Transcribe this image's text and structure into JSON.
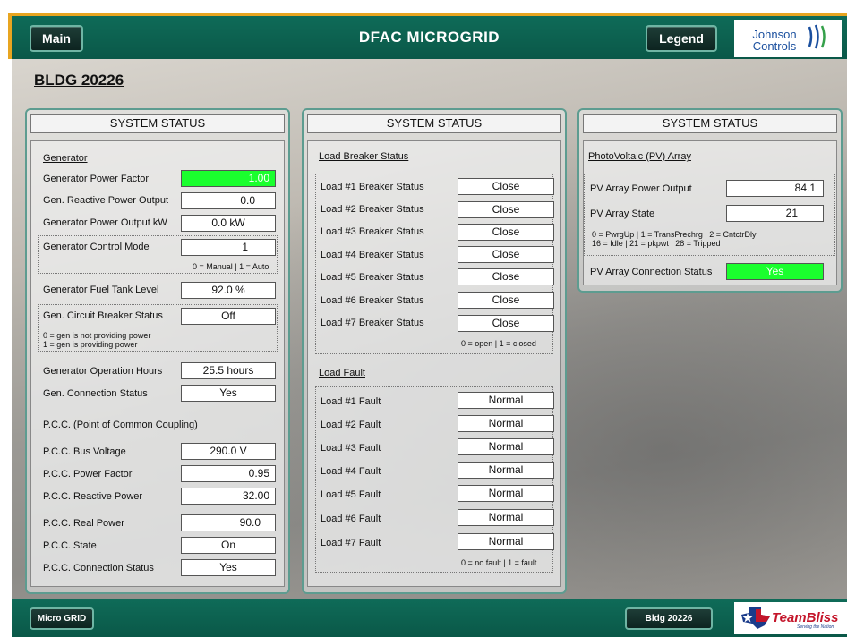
{
  "header": {
    "title": "DFAC MICROGRID",
    "main_label": "Main",
    "legend_label": "Legend",
    "logo_text_line1": "Johnson",
    "logo_text_line2": "Controls"
  },
  "page": {
    "building_title": "BLDG 20226"
  },
  "gen_panel": {
    "heading": "SYSTEM STATUS",
    "generator_section": "Generator",
    "power_factor_label": "Generator Power Factor",
    "power_factor_value": "1.00",
    "reactive_label": "Gen. Reactive Power Output",
    "reactive_value": "0.0",
    "output_kw_label": "Generator Power Output kW",
    "output_kw_value": "0.0 kW",
    "control_mode_label": "Generator Control Mode",
    "control_mode_value": "1",
    "control_mode_note": "0 = Manual | 1 = Auto",
    "fuel_label": "Generator Fuel Tank Level",
    "fuel_value": "92.0 %",
    "breaker_label": "Gen. Circuit Breaker Status",
    "breaker_value": "Off",
    "breaker_note1": "0 = gen is not providing power",
    "breaker_note2": "1 = gen is providing power",
    "hours_label": "Generator Operation Hours",
    "hours_value": "25.5 hours",
    "conn_label": "Gen. Connection Status",
    "conn_value": "Yes",
    "pcc_section": "P.C.C. (Point of Common Coupling)",
    "pcc_voltage_label": "P.C.C. Bus Voltage",
    "pcc_voltage_value": "290.0 V",
    "pcc_pf_label": "P.C.C. Power Factor",
    "pcc_pf_value": "0.95",
    "pcc_reactive_label": "P.C.C. Reactive Power",
    "pcc_reactive_value": "32.00",
    "pcc_real_label": "P.C.C. Real Power",
    "pcc_real_value": "90.0",
    "pcc_state_label": "P.C.C. State",
    "pcc_state_value": "On",
    "pcc_conn_label": "P.C.C. Connection Status",
    "pcc_conn_value": "Yes"
  },
  "load_panel": {
    "heading": "SYSTEM STATUS",
    "breaker_section": "Load Breaker Status",
    "breakers": [
      {
        "label": "Load #1 Breaker Status",
        "value": "Close"
      },
      {
        "label": "Load #2 Breaker Status",
        "value": "Close"
      },
      {
        "label": "Load #3 Breaker Status",
        "value": "Close"
      },
      {
        "label": "Load #4 Breaker Status",
        "value": "Close"
      },
      {
        "label": "Load #5 Breaker Status",
        "value": "Close"
      },
      {
        "label": "Load #6 Breaker Status",
        "value": "Close"
      },
      {
        "label": "Load #7 Breaker Status",
        "value": "Close"
      }
    ],
    "breaker_note": "0 = open | 1 = closed",
    "fault_section": "Load Fault",
    "faults": [
      {
        "label": "Load #1 Fault",
        "value": "Normal"
      },
      {
        "label": "Load #2 Fault",
        "value": "Normal"
      },
      {
        "label": "Load #3 Fault",
        "value": "Normal"
      },
      {
        "label": "Load #4 Fault",
        "value": "Normal"
      },
      {
        "label": "Load #5 Fault",
        "value": "Normal"
      },
      {
        "label": "Load #6 Fault",
        "value": "Normal"
      },
      {
        "label": "Load #7 Fault",
        "value": "Normal"
      }
    ],
    "fault_note": "0 = no fault | 1 = fault"
  },
  "pv_panel": {
    "heading": "SYSTEM STATUS",
    "section": "PhotoVoltaic (PV) Array",
    "output_label": "PV Array Power Output",
    "output_value": "84.1",
    "state_label": "PV Array State",
    "state_value": "21",
    "state_note1": "0 = PwrgUp | 1 = TransPrechrg | 2 = CntctrDly",
    "state_note2": "16 = Idle | 21 = pkpwt | 28 = Tripped",
    "conn_label": "PV Array Connection Status",
    "conn_value": "Yes"
  },
  "footer": {
    "microgrid_label": "Micro GRID",
    "bldg_label": "Bldg 20226",
    "teambliss_text": "TeamBliss",
    "teambliss_tagline": "Serving the Nation"
  },
  "colors": {
    "header_teal": "#0f6b58",
    "ok_green": "#1aff2e",
    "accent_orange": "#e8a520",
    "panel_border": "#5d9c90"
  }
}
